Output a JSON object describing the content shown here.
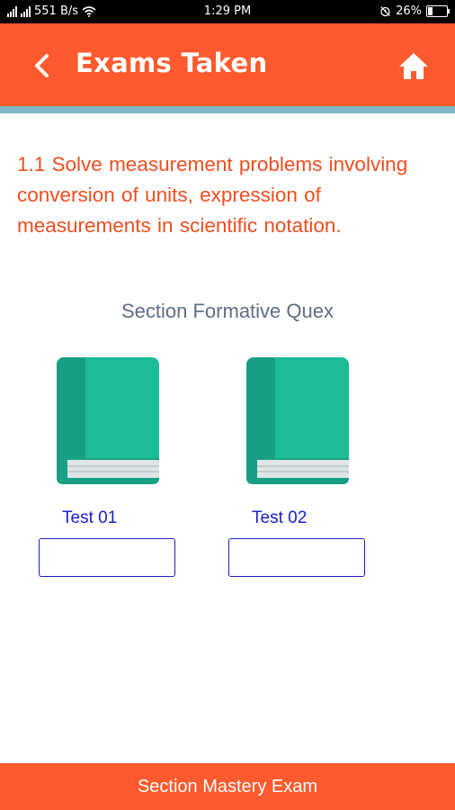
{
  "status_bar": {
    "network": "551 B/s",
    "time": "1:29 PM",
    "battery": "26%",
    "battery_level": 0.26,
    "icons": [
      "signal-icon",
      "wifi-icon",
      "alarm-icon",
      "battery-icon"
    ]
  },
  "header": {
    "title": "Exams Taken",
    "back_icon": "chevron-left-icon",
    "home_icon": "home-icon"
  },
  "topic": "1.1 Solve measurement problems involving conversion of units, expression of measurements in scientific notation.",
  "section_title": "Section Formative Quex",
  "tests": [
    {
      "label": "Test 01",
      "score": "",
      "icon": "book-icon"
    },
    {
      "label": "Test 02",
      "score": "",
      "icon": "book-icon"
    }
  ],
  "footer_button": "Section Mastery Exam",
  "colors": {
    "primary": "#ff5a2d",
    "divider": "#7fb6c6",
    "topic_text": "#ef4d1e",
    "book_cover": "#1dbc99",
    "book_spine": "#17a083",
    "link_blue": "#1a20c8"
  }
}
